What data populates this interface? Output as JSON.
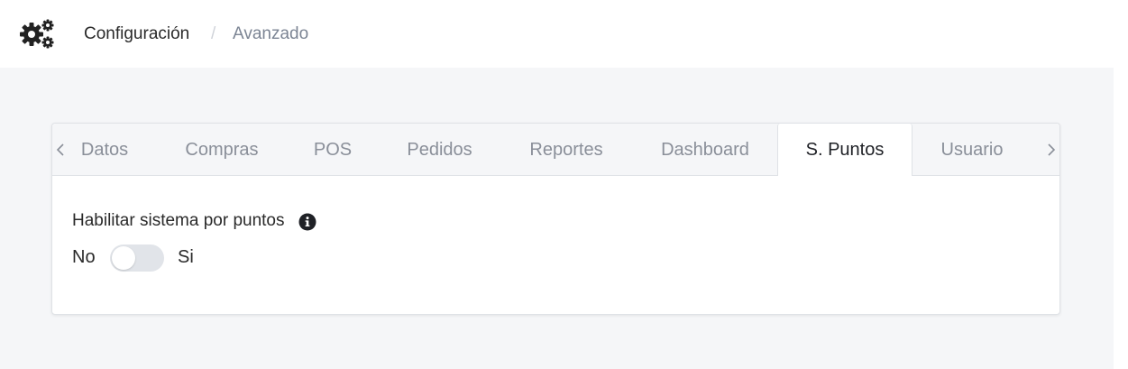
{
  "header": {
    "icon": "gears-icon",
    "breadcrumb_main": "Configuración",
    "breadcrumb_separator": "/",
    "breadcrumb_current": "Avanzado"
  },
  "tabs": {
    "items": [
      {
        "label": "Datos"
      },
      {
        "label": "Compras"
      },
      {
        "label": "POS"
      },
      {
        "label": "Pedidos"
      },
      {
        "label": "Reportes"
      },
      {
        "label": "Dashboard"
      },
      {
        "label": "S. Puntos"
      },
      {
        "label": "Usuario"
      }
    ],
    "active_label": "S. Puntos"
  },
  "panel": {
    "field_label": "Habilitar sistema por puntos",
    "info_icon": "info-circle-icon",
    "toggle_off_label": "No",
    "toggle_on_label": "Si",
    "toggle_enabled": false
  },
  "colors": {
    "page_background": "#f5f6f8",
    "header_background": "#ffffff",
    "tab_inactive_text": "#8a8f99",
    "tab_active_text": "#1f2126",
    "toggle_off": "#e1e4e9"
  }
}
